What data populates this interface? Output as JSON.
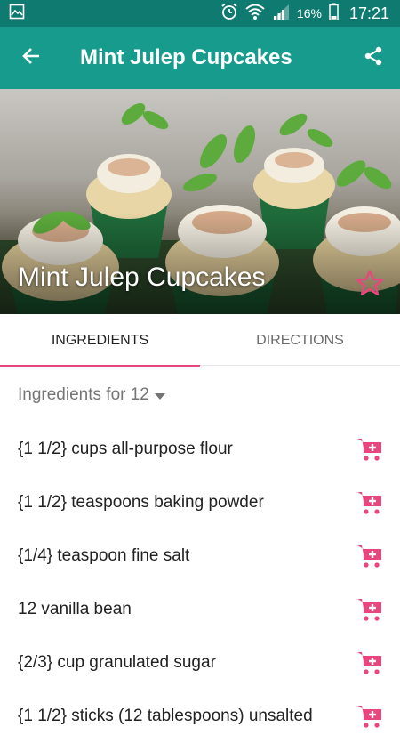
{
  "status_bar": {
    "left_icon": "gallery-icon",
    "icons": [
      "alarm-icon",
      "wifi-icon",
      "signal-icon"
    ],
    "battery": "16%",
    "time": "17:21"
  },
  "app_bar": {
    "title": "Mint Julep Cupcakes",
    "back_icon": "arrow-back-icon",
    "share_icon": "share-icon"
  },
  "hero": {
    "title": "Mint Julep Cupcakes",
    "favorite_icon": "star-outline-icon"
  },
  "tabs": [
    {
      "label": "INGREDIENTS",
      "active": true
    },
    {
      "label": "DIRECTIONS",
      "active": false
    }
  ],
  "servings": {
    "label": "Ingredients for 12"
  },
  "ingredients": [
    {
      "text": "{1 1/2} cups all-purpose flour"
    },
    {
      "text": "{1 1/2} teaspoons baking powder"
    },
    {
      "text": "{1/4} teaspoon fine salt"
    },
    {
      "text": "12 vanilla bean"
    },
    {
      "text": "{2/3} cup granulated sugar"
    },
    {
      "text": "{1 1/2} sticks (12 tablespoons) unsalted"
    }
  ],
  "colors": {
    "status_bar": "#0e7a70",
    "app_bar": "#169b8c",
    "accent": "#e8467c"
  }
}
